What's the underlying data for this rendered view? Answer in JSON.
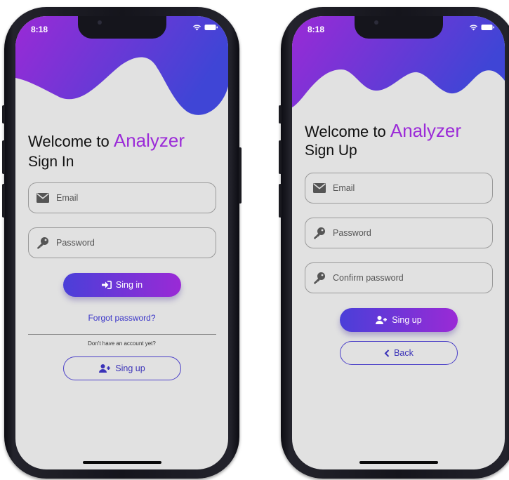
{
  "status_bar": {
    "time": "8:18"
  },
  "colors": {
    "brand": "#9b2bd8",
    "gradient_start": "#4a3fd8",
    "gradient_end": "#9a2ad6",
    "link": "#3b36c8",
    "screen_bg": "#e1e1e1"
  },
  "signin": {
    "welcome": "Welcome to",
    "brand": "Analyzer",
    "subtitle": "Sign In",
    "email_placeholder": "Email",
    "password_placeholder": "Password",
    "signin_label": "Sing in",
    "forgot_label": "Forgot password?",
    "no_account_text": "Don't have an account yet?",
    "signup_label": "Sing up"
  },
  "signup": {
    "welcome": "Welcome to",
    "brand": "Analyzer",
    "subtitle": "Sign Up",
    "email_placeholder": "Email",
    "password_placeholder": "Password",
    "confirm_placeholder": "Confirm password",
    "signup_label": "Sing up",
    "back_label": "Back"
  },
  "icons": [
    "envelope-icon",
    "key-icon",
    "sign-in-icon",
    "user-plus-icon",
    "chevron-left-icon",
    "wifi-icon",
    "battery-icon"
  ]
}
